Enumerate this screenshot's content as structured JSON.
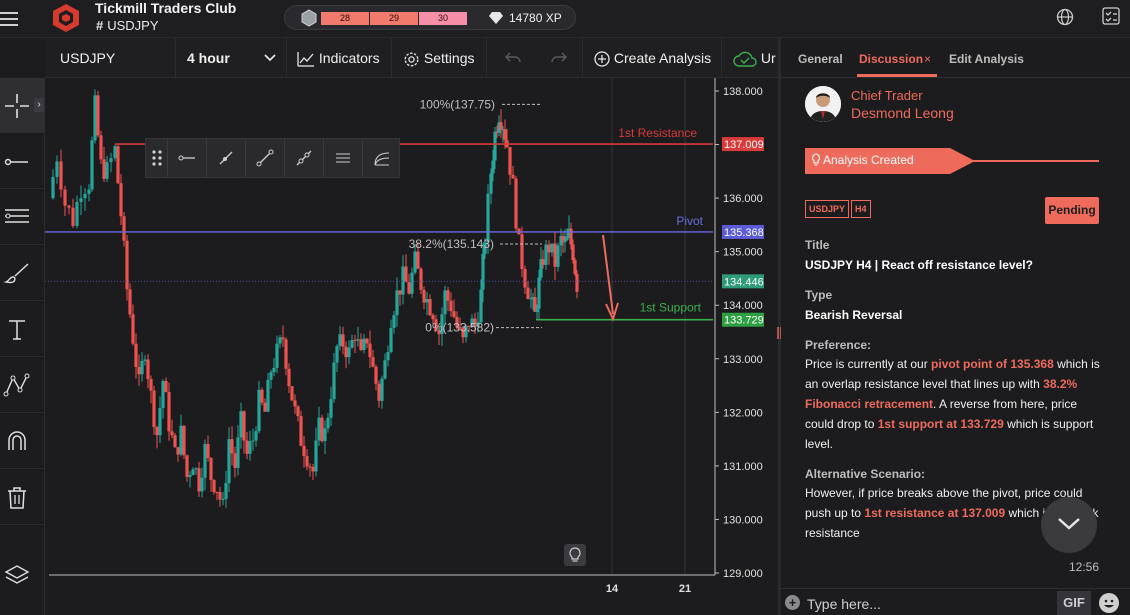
{
  "app": {
    "title": "Tickmill Traders Club",
    "channel": "USDJPY"
  },
  "xp": {
    "levels": [
      "28",
      "29",
      "30"
    ],
    "value": "14780 XP",
    "level_colors": [
      "#f07a6b",
      "#f07a6b",
      "#f58fa8"
    ]
  },
  "toolbar": {
    "symbol": "USDJPY",
    "interval": "4 hour",
    "indicators": "Indicators",
    "settings": "Settings",
    "create": "Create Analysis",
    "truncated": "Ur"
  },
  "left_tools": [
    "crosshair-icon",
    "line-icon",
    "fib-icon",
    "brush-icon",
    "text-icon",
    "pattern-icon",
    "magnet-icon",
    "trash-icon",
    "layers-icon"
  ],
  "chart_data": {
    "type": "candlestick",
    "symbol": "USDJPY",
    "interval": "4 hour",
    "ylim": [
      129.0,
      138.0
    ],
    "y_ticks": [
      "138.000",
      "137.000",
      "136.000",
      "135.000",
      "134.000",
      "133.000",
      "132.000",
      "131.000",
      "130.000",
      "129.000"
    ],
    "x_ticks": [
      "14",
      "21"
    ],
    "price_tags": [
      {
        "label": "137.009",
        "value": 137.009,
        "color": "#d93a3a"
      },
      {
        "label": "135.368",
        "value": 135.368,
        "color": "#5b5bd6"
      },
      {
        "label": "134.446",
        "value": 134.446,
        "color": "#2e9a7a"
      },
      {
        "label": "133.729",
        "value": 133.729,
        "color": "#2ea043"
      }
    ],
    "levels": [
      {
        "name": "1st Resistance",
        "value": 137.009,
        "color": "#d93a3a"
      },
      {
        "name": "Pivot",
        "value": 135.368,
        "color": "#6a6ae0"
      },
      {
        "name": "1st Support",
        "value": 133.729,
        "color": "#3ab04a"
      }
    ],
    "fib_labels": [
      "100%(137.75)",
      "38.2%(135.143)",
      "0%(133.582)"
    ],
    "fib_values": [
      137.75,
      135.143,
      133.582
    ],
    "colors": {
      "up": "#26a69a",
      "down": "#ef5350"
    }
  },
  "panel": {
    "tabs": [
      "General",
      "Discussion",
      "Edit Analysis"
    ],
    "active_tab": "Discussion",
    "close": "×",
    "author_role": "Chief Trader",
    "author_name": "Desmond Leong",
    "banner": "Analysis Created",
    "tags": [
      "USDJPY",
      "H4"
    ],
    "status": "Pending",
    "title_label": "Title",
    "title_value": "USDJPY H4 | React off resistance level?",
    "type_label": "Type",
    "type_value": "Bearish Reversal",
    "pref_label": "Preference:",
    "pref_1": "Price is currently at our ",
    "pref_hl1": "pivot point of 135.368",
    "pref_2": " which is an overlap resistance level that lines up with ",
    "pref_hl2": "38.2% Fibonacci retracement",
    "pref_3": ". A reverse from here, price could drop to ",
    "pref_hl3": "1st support at 133.729",
    "pref_4": " which is support level.",
    "alt_label": "Alternative Scenario:",
    "alt_1": "However, if price breaks above the pivot, price could push up to ",
    "alt_hl1": "1st resistance at 137.009",
    "alt_2": " which is pullback resistance",
    "time": "12:56",
    "input_placeholder": "Type here...",
    "gif": "GIF"
  }
}
